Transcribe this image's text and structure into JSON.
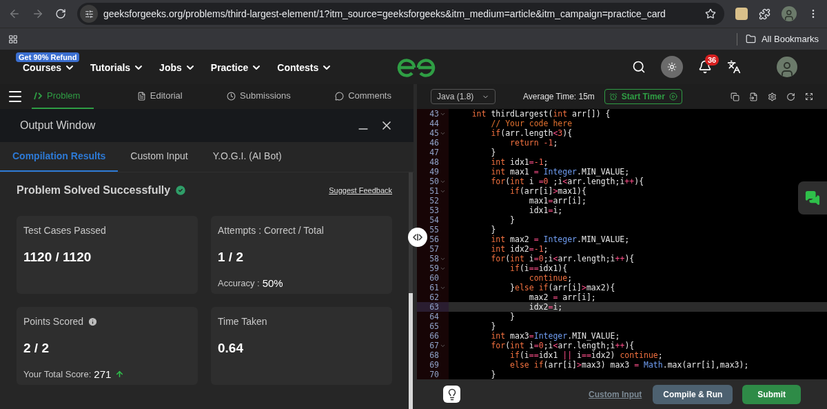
{
  "browser": {
    "url": "geeksforgeeks.org/problems/third-largest-element/1?itm_source=geeksforgeeks&itm_medium=article&itm_campaign=practice_card",
    "bookmarks_label": "All Bookmarks"
  },
  "site_nav": {
    "promo_badge": "Get 90% Refund",
    "items": [
      "Courses",
      "Tutorials",
      "Jobs",
      "Practice",
      "Contests"
    ],
    "notification_count": "36"
  },
  "problem_tabs": [
    {
      "label": "Problem",
      "selected": true
    },
    {
      "label": "Editorial",
      "selected": false
    },
    {
      "label": "Submissions",
      "selected": false
    },
    {
      "label": "Comments",
      "selected": false
    }
  ],
  "output_window": {
    "title": "Output Window",
    "tabs": [
      {
        "label": "Compilation Results",
        "selected": true
      },
      {
        "label": "Custom Input",
        "selected": false
      },
      {
        "label": "Y.O.G.I. (AI Bot)",
        "selected": false
      }
    ],
    "status": "Problem Solved Successfully",
    "feedback_link": "Suggest Feedback",
    "cards": [
      {
        "label": "Test Cases Passed",
        "value": "1120 / 1120",
        "info": false
      },
      {
        "label": "Attempts : Correct / Total",
        "value": "1 / 2",
        "info": false,
        "note_label": "Accuracy :",
        "note_value": "50%",
        "rising": false
      },
      {
        "label": "Points Scored",
        "value": "2 / 2",
        "info": true,
        "note_label": "Your Total Score:",
        "note_value": "271",
        "rising": true
      },
      {
        "label": "Time Taken",
        "value": "0.64",
        "info": false
      }
    ]
  },
  "editor": {
    "language": "Java (1.8)",
    "average_time": "Average Time: 15m",
    "timer_button": "Start Timer",
    "lines": [
      {
        "num": "43",
        "fold": true,
        "current": false,
        "tokens": [
          {
            "kind": "kw",
            "text": "    int"
          },
          {
            "kind": "p",
            "text": " thirdLargest("
          },
          {
            "kind": "kw",
            "text": "int"
          },
          {
            "kind": "p",
            "text": " arr[]) {"
          }
        ]
      },
      {
        "num": "44",
        "fold": false,
        "current": false,
        "tokens": [
          {
            "kind": "cm",
            "text": "        // Your code here"
          }
        ]
      },
      {
        "num": "45",
        "fold": true,
        "current": false,
        "tokens": [
          {
            "kind": "kw",
            "text": "        if"
          },
          {
            "kind": "p",
            "text": "(arr.length"
          },
          {
            "kind": "op",
            "text": "<"
          },
          {
            "kind": "num",
            "text": "3"
          },
          {
            "kind": "p",
            "text": "){"
          }
        ]
      },
      {
        "num": "46",
        "fold": false,
        "current": false,
        "tokens": [
          {
            "kind": "kw",
            "text": "            return"
          },
          {
            "kind": "num",
            "text": " -1"
          },
          {
            "kind": "p",
            "text": ";"
          }
        ]
      },
      {
        "num": "47",
        "fold": false,
        "current": false,
        "tokens": [
          {
            "kind": "p",
            "text": "        }"
          }
        ]
      },
      {
        "num": "48",
        "fold": false,
        "current": false,
        "tokens": [
          {
            "kind": "kw",
            "text": "        int"
          },
          {
            "kind": "p",
            "text": " idx1"
          },
          {
            "kind": "op",
            "text": "="
          },
          {
            "kind": "num",
            "text": "-1"
          },
          {
            "kind": "p",
            "text": ";"
          }
        ]
      },
      {
        "num": "49",
        "fold": false,
        "current": false,
        "tokens": [
          {
            "kind": "kw",
            "text": "        int"
          },
          {
            "kind": "p",
            "text": " max1 "
          },
          {
            "kind": "op",
            "text": "="
          },
          {
            "kind": "ty",
            "text": " Integer"
          },
          {
            "kind": "p",
            "text": ".MIN_VALUE;"
          }
        ]
      },
      {
        "num": "50",
        "fold": true,
        "current": false,
        "tokens": [
          {
            "kind": "kw",
            "text": "        for"
          },
          {
            "kind": "p",
            "text": "("
          },
          {
            "kind": "kw",
            "text": "int"
          },
          {
            "kind": "p",
            "text": " i "
          },
          {
            "kind": "op",
            "text": "="
          },
          {
            "kind": "num",
            "text": "0"
          },
          {
            "kind": "p",
            "text": " ;i"
          },
          {
            "kind": "op",
            "text": "<"
          },
          {
            "kind": "p",
            "text": "arr.length;i"
          },
          {
            "kind": "op",
            "text": "++"
          },
          {
            "kind": "p",
            "text": "){"
          }
        ]
      },
      {
        "num": "51",
        "fold": true,
        "current": false,
        "tokens": [
          {
            "kind": "kw",
            "text": "            if"
          },
          {
            "kind": "p",
            "text": "(arr[i]"
          },
          {
            "kind": "op",
            "text": ">"
          },
          {
            "kind": "p",
            "text": "max1){"
          }
        ]
      },
      {
        "num": "52",
        "fold": false,
        "current": false,
        "tokens": [
          {
            "kind": "p",
            "text": "                max1"
          },
          {
            "kind": "op",
            "text": "="
          },
          {
            "kind": "p",
            "text": "arr[i];"
          }
        ]
      },
      {
        "num": "53",
        "fold": false,
        "current": false,
        "tokens": [
          {
            "kind": "p",
            "text": "                idx1"
          },
          {
            "kind": "op",
            "text": "="
          },
          {
            "kind": "p",
            "text": "i;"
          }
        ]
      },
      {
        "num": "54",
        "fold": false,
        "current": false,
        "tokens": [
          {
            "kind": "p",
            "text": "            }"
          }
        ]
      },
      {
        "num": "55",
        "fold": false,
        "current": false,
        "tokens": [
          {
            "kind": "p",
            "text": "        }"
          }
        ]
      },
      {
        "num": "56",
        "fold": false,
        "current": false,
        "tokens": [
          {
            "kind": "kw",
            "text": "        int"
          },
          {
            "kind": "p",
            "text": " max2 "
          },
          {
            "kind": "op",
            "text": "="
          },
          {
            "kind": "ty",
            "text": " Integer"
          },
          {
            "kind": "p",
            "text": ".MIN_VALUE;"
          }
        ]
      },
      {
        "num": "57",
        "fold": false,
        "current": false,
        "tokens": [
          {
            "kind": "kw",
            "text": "        int"
          },
          {
            "kind": "p",
            "text": " idx2"
          },
          {
            "kind": "op",
            "text": "="
          },
          {
            "kind": "num",
            "text": "-1"
          },
          {
            "kind": "p",
            "text": ";"
          }
        ]
      },
      {
        "num": "58",
        "fold": true,
        "current": false,
        "tokens": [
          {
            "kind": "kw",
            "text": "        for"
          },
          {
            "kind": "p",
            "text": "("
          },
          {
            "kind": "kw",
            "text": "int"
          },
          {
            "kind": "p",
            "text": " i"
          },
          {
            "kind": "op",
            "text": "="
          },
          {
            "kind": "num",
            "text": "0"
          },
          {
            "kind": "p",
            "text": ";i"
          },
          {
            "kind": "op",
            "text": "<"
          },
          {
            "kind": "p",
            "text": "arr.length;i"
          },
          {
            "kind": "op",
            "text": "++"
          },
          {
            "kind": "p",
            "text": "){"
          }
        ]
      },
      {
        "num": "59",
        "fold": true,
        "current": false,
        "tokens": [
          {
            "kind": "kw",
            "text": "            if"
          },
          {
            "kind": "p",
            "text": "(i"
          },
          {
            "kind": "op",
            "text": "=="
          },
          {
            "kind": "p",
            "text": "idx1){"
          }
        ]
      },
      {
        "num": "60",
        "fold": false,
        "current": false,
        "tokens": [
          {
            "kind": "kw",
            "text": "                continue"
          },
          {
            "kind": "p",
            "text": ";"
          }
        ]
      },
      {
        "num": "61",
        "fold": true,
        "current": false,
        "tokens": [
          {
            "kind": "p",
            "text": "            }"
          },
          {
            "kind": "kw",
            "text": "else"
          },
          {
            "kind": "kw",
            "text": " if"
          },
          {
            "kind": "p",
            "text": "(arr[i]"
          },
          {
            "kind": "op",
            "text": ">"
          },
          {
            "kind": "p",
            "text": "max2){"
          }
        ]
      },
      {
        "num": "62",
        "fold": false,
        "current": false,
        "tokens": [
          {
            "kind": "p",
            "text": "                max2 "
          },
          {
            "kind": "op",
            "text": "="
          },
          {
            "kind": "p",
            "text": " arr[i];"
          }
        ]
      },
      {
        "num": "63",
        "fold": false,
        "current": true,
        "tokens": [
          {
            "kind": "p",
            "text": "                idx2"
          },
          {
            "kind": "op",
            "text": "="
          },
          {
            "kind": "p",
            "text": "i;"
          }
        ]
      },
      {
        "num": "64",
        "fold": false,
        "current": false,
        "tokens": [
          {
            "kind": "p",
            "text": "            }"
          }
        ]
      },
      {
        "num": "65",
        "fold": false,
        "current": false,
        "tokens": [
          {
            "kind": "p",
            "text": "        }"
          }
        ]
      },
      {
        "num": "66",
        "fold": false,
        "current": false,
        "tokens": [
          {
            "kind": "kw",
            "text": "        int"
          },
          {
            "kind": "p",
            "text": " max3"
          },
          {
            "kind": "op",
            "text": "="
          },
          {
            "kind": "ty",
            "text": "Integer"
          },
          {
            "kind": "p",
            "text": ".MIN_VALUE;"
          }
        ]
      },
      {
        "num": "67",
        "fold": true,
        "current": false,
        "tokens": [
          {
            "kind": "kw",
            "text": "        for"
          },
          {
            "kind": "p",
            "text": "("
          },
          {
            "kind": "kw",
            "text": "int"
          },
          {
            "kind": "p",
            "text": " i"
          },
          {
            "kind": "op",
            "text": "="
          },
          {
            "kind": "num",
            "text": "0"
          },
          {
            "kind": "p",
            "text": ";i"
          },
          {
            "kind": "op",
            "text": "<"
          },
          {
            "kind": "p",
            "text": "arr.length;i"
          },
          {
            "kind": "op",
            "text": "++"
          },
          {
            "kind": "p",
            "text": "){"
          }
        ]
      },
      {
        "num": "68",
        "fold": false,
        "current": false,
        "tokens": [
          {
            "kind": "kw",
            "text": "            if"
          },
          {
            "kind": "p",
            "text": "(i"
          },
          {
            "kind": "op",
            "text": "=="
          },
          {
            "kind": "p",
            "text": "idx1 "
          },
          {
            "kind": "op",
            "text": "||"
          },
          {
            "kind": "p",
            "text": " i"
          },
          {
            "kind": "op",
            "text": "=="
          },
          {
            "kind": "p",
            "text": "idx2) "
          },
          {
            "kind": "kw",
            "text": "continue"
          },
          {
            "kind": "p",
            "text": ";"
          }
        ]
      },
      {
        "num": "69",
        "fold": false,
        "current": false,
        "tokens": [
          {
            "kind": "kw",
            "text": "            else"
          },
          {
            "kind": "kw",
            "text": " if"
          },
          {
            "kind": "p",
            "text": "(arr[i]"
          },
          {
            "kind": "op",
            "text": ">"
          },
          {
            "kind": "p",
            "text": "max3) max3 "
          },
          {
            "kind": "op",
            "text": "="
          },
          {
            "kind": "ty",
            "text": " Math"
          },
          {
            "kind": "p",
            "text": ".max(arr[i],max3);"
          }
        ]
      },
      {
        "num": "70",
        "fold": false,
        "current": false,
        "tokens": [
          {
            "kind": "p",
            "text": "        }"
          }
        ]
      }
    ],
    "custom_input_link": "Custom Input",
    "run_button": "Compile & Run",
    "submit_button": "Submit"
  }
}
